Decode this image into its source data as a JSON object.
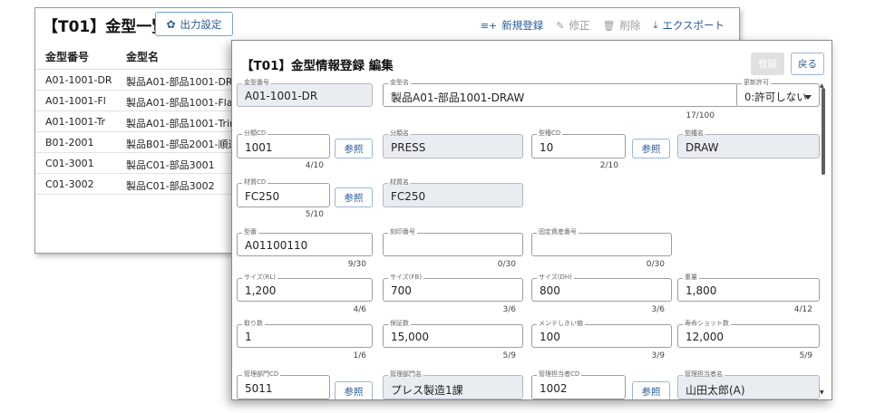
{
  "list": {
    "title": "【T01】金型一覧",
    "output_settings": "出力設定",
    "actions": [
      {
        "label": "新規登録",
        "icon": "new-icon",
        "enabled": true
      },
      {
        "label": "修正",
        "icon": "pencil-icon",
        "enabled": false
      },
      {
        "label": "削除",
        "icon": "trash-icon",
        "enabled": false
      },
      {
        "label": "エクスポート",
        "icon": "download-icon",
        "enabled": true
      }
    ],
    "columns": [
      "金型番号",
      "金型名"
    ],
    "rows": [
      [
        "A01-1001-DR",
        "製品A01-部品1001-DRAW"
      ],
      [
        "A01-1001-Fl",
        "製品A01-部品1001-Flange"
      ],
      [
        "A01-1001-Tr",
        "製品A01-部品1001-Trim"
      ],
      [
        "B01-2001",
        "製品B01-部品2001-順送"
      ],
      [
        "C01-3001",
        "製品C01-部品3001"
      ],
      [
        "C01-3002",
        "製品C01-部品3002"
      ]
    ]
  },
  "modal": {
    "title": "【T01】金型情報登録 編集",
    "register": "登録",
    "back": "戻る",
    "ref_label": "参照",
    "fields": {
      "mold_no": {
        "label": "金型番号",
        "value": "A01-1001-DR"
      },
      "mold_name": {
        "label": "金型名",
        "value": "製品A01-部品1001-DRAW",
        "count": "17/100"
      },
      "update_perm": {
        "label": "更新許可",
        "value": "0:許可しない"
      },
      "class_cd": {
        "label": "分類CD",
        "value": "1001",
        "count": "4/10"
      },
      "class_name": {
        "label": "分類名",
        "value": "PRESS"
      },
      "type_cd": {
        "label": "型種CD",
        "value": "10",
        "count": "2/10"
      },
      "type_name": {
        "label": "型種名",
        "value": "DRAW"
      },
      "material_cd": {
        "label": "材質CD",
        "value": "FC250",
        "count": "5/10"
      },
      "material_name": {
        "label": "材質名",
        "value": "FC250"
      },
      "model_no": {
        "label": "型番",
        "value": "A01100110",
        "count": "9/30"
      },
      "stamp_no": {
        "label": "刻印番号",
        "value": "",
        "count": "0/30"
      },
      "asset_no": {
        "label": "固定資産番号",
        "value": "",
        "count": "0/30"
      },
      "size_rl": {
        "label": "サイズ(RL)",
        "value": "1,200",
        "count": "4/6"
      },
      "size_fb": {
        "label": "サイズ(FB)",
        "value": "700",
        "count": "3/6"
      },
      "size_dh": {
        "label": "サイズ(DH)",
        "value": "800",
        "count": "3/6"
      },
      "weight": {
        "label": "重量",
        "value": "1,800",
        "count": "4/12"
      },
      "cavities": {
        "label": "取り数",
        "value": "1",
        "count": "1/6"
      },
      "guarantee": {
        "label": "保証数",
        "value": "15,000",
        "count": "5/9"
      },
      "maint_threshold": {
        "label": "メンテしきい値",
        "value": "100",
        "count": "3/9"
      },
      "life_shots": {
        "label": "寿命ショット数",
        "value": "12,000",
        "count": "5/9"
      },
      "dept_cd": {
        "label": "管理部門CD",
        "value": "5011"
      },
      "dept_name": {
        "label": "管理部門名",
        "value": "プレス製造1課"
      },
      "person_cd": {
        "label": "管理担当者CD",
        "value": "1002"
      },
      "person_name": {
        "label": "管理担当者名",
        "value": "山田太郎(A)"
      }
    }
  }
}
